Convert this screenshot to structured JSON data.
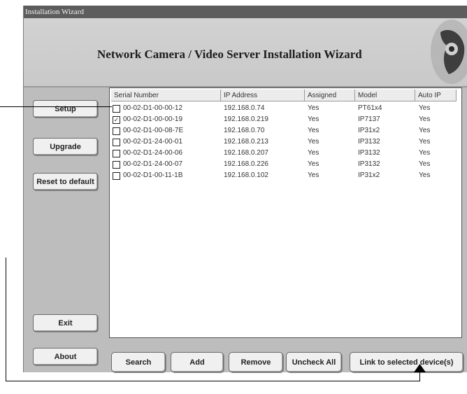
{
  "window": {
    "title": "Installation Wizard"
  },
  "banner": {
    "title": "Network Camera / Video Server Installation Wizard"
  },
  "sidebar": {
    "setup": "Setup",
    "upgrade": "Upgrade",
    "reset": "Reset to default",
    "exit": "Exit",
    "about": "About"
  },
  "table": {
    "headers": [
      "Serial Number",
      "IP Address",
      "Assigned",
      "Model",
      "Auto IP"
    ],
    "rows": [
      {
        "checked": false,
        "serial": "00-02-D1-00-00-12",
        "ip": "192.168.0.74",
        "assigned": "Yes",
        "model": "PT61x4",
        "auto_ip": "Yes"
      },
      {
        "checked": true,
        "serial": "00-02-D1-00-00-19",
        "ip": "192.168.0.219",
        "assigned": "Yes",
        "model": "IP7137",
        "auto_ip": "Yes"
      },
      {
        "checked": false,
        "serial": "00-02-D1-00-08-7E",
        "ip": "192.168.0.70",
        "assigned": "Yes",
        "model": "IP31x2",
        "auto_ip": "Yes"
      },
      {
        "checked": false,
        "serial": "00-02-D1-24-00-01",
        "ip": "192.168.0.213",
        "assigned": "Yes",
        "model": "IP3132",
        "auto_ip": "Yes"
      },
      {
        "checked": false,
        "serial": "00-02-D1-24-00-06",
        "ip": "192.168.0.207",
        "assigned": "Yes",
        "model": "IP3132",
        "auto_ip": "Yes"
      },
      {
        "checked": false,
        "serial": "00-02-D1-24-00-07",
        "ip": "192.168.0.226",
        "assigned": "Yes",
        "model": "IP3132",
        "auto_ip": "Yes"
      },
      {
        "checked": false,
        "serial": "00-02-D1-00-11-1B",
        "ip": "192.168.0.102",
        "assigned": "Yes",
        "model": "IP31x2",
        "auto_ip": "Yes"
      }
    ]
  },
  "buttons": {
    "search": "Search",
    "add": "Add",
    "remove": "Remove",
    "uncheck_all": "Uncheck All",
    "link": "Link to selected device(s)"
  },
  "colors": {
    "title_bar": "#5d5d5d",
    "window_bg": "#bdbdbd",
    "button_bg": "#f0f0f0"
  },
  "icons": {
    "banner": "camera-icon",
    "check": "checkmark-icon",
    "arrow": "arrow-up-icon"
  }
}
